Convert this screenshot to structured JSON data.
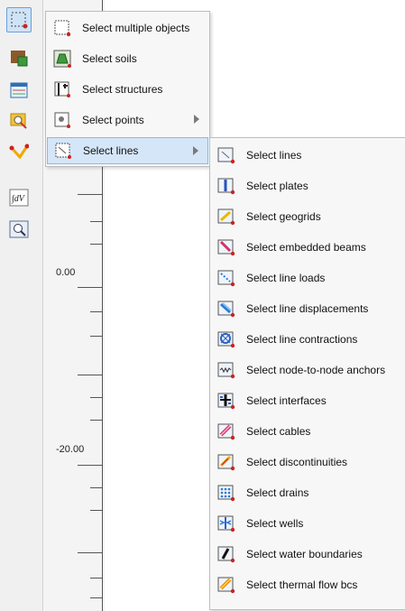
{
  "toolbar": {
    "buttons": [
      {
        "name": "selection-tool-button",
        "icon": "selection-rectangle-icon",
        "active": true
      },
      {
        "name": "soil-tool-button",
        "icon": "soil-block-icon"
      },
      {
        "name": "table-tool-button",
        "icon": "table-icon"
      },
      {
        "name": "view-tool-button",
        "icon": "magnifier-icon"
      },
      {
        "name": "line-tool-button",
        "icon": "polyline-icon"
      },
      {
        "name": "formula-tool-button",
        "icon": "integral-icon",
        "text": "∫dV"
      },
      {
        "name": "zoom-tool-button",
        "icon": "zoom-window-icon"
      }
    ]
  },
  "ruler": {
    "labels": [
      "0.00",
      "-20.00"
    ]
  },
  "select_menu": {
    "items": [
      {
        "label": "Select multiple objects",
        "icon": "multi-select-icon",
        "has_submenu": false
      },
      {
        "label": "Select soils",
        "icon": "soil-select-icon",
        "has_submenu": false
      },
      {
        "label": "Select structures",
        "icon": "structure-select-icon",
        "has_submenu": false
      },
      {
        "label": "Select points",
        "icon": "point-select-icon",
        "has_submenu": true
      },
      {
        "label": "Select lines",
        "icon": "line-select-icon",
        "has_submenu": true,
        "selected": true
      }
    ]
  },
  "lines_submenu": {
    "items": [
      {
        "label": "Select lines",
        "icon": "line-icon"
      },
      {
        "label": "Select plates",
        "icon": "plate-icon"
      },
      {
        "label": "Select geogrids",
        "icon": "geogrid-icon"
      },
      {
        "label": "Select embedded beams",
        "icon": "embedded-beam-icon"
      },
      {
        "label": "Select line loads",
        "icon": "line-load-icon"
      },
      {
        "label": "Select line displacements",
        "icon": "line-displacement-icon"
      },
      {
        "label": "Select line contractions",
        "icon": "line-contraction-icon"
      },
      {
        "label": "Select node-to-node anchors",
        "icon": "anchor-icon"
      },
      {
        "label": "Select interfaces",
        "icon": "interface-icon"
      },
      {
        "label": "Select cables",
        "icon": "cable-icon"
      },
      {
        "label": "Select discontinuities",
        "icon": "discontinuity-icon"
      },
      {
        "label": "Select drains",
        "icon": "drain-icon"
      },
      {
        "label": "Select wells",
        "icon": "well-icon"
      },
      {
        "label": "Select water boundaries",
        "icon": "water-boundary-icon"
      },
      {
        "label": "Select thermal flow bcs",
        "icon": "thermal-flow-icon"
      }
    ]
  },
  "colors": {
    "menu_bg": "#f7f7f7",
    "selection_bg": "#d4e6f8",
    "selection_border": "#8fb8e0",
    "toolbar_bg": "#f0f0f0"
  }
}
